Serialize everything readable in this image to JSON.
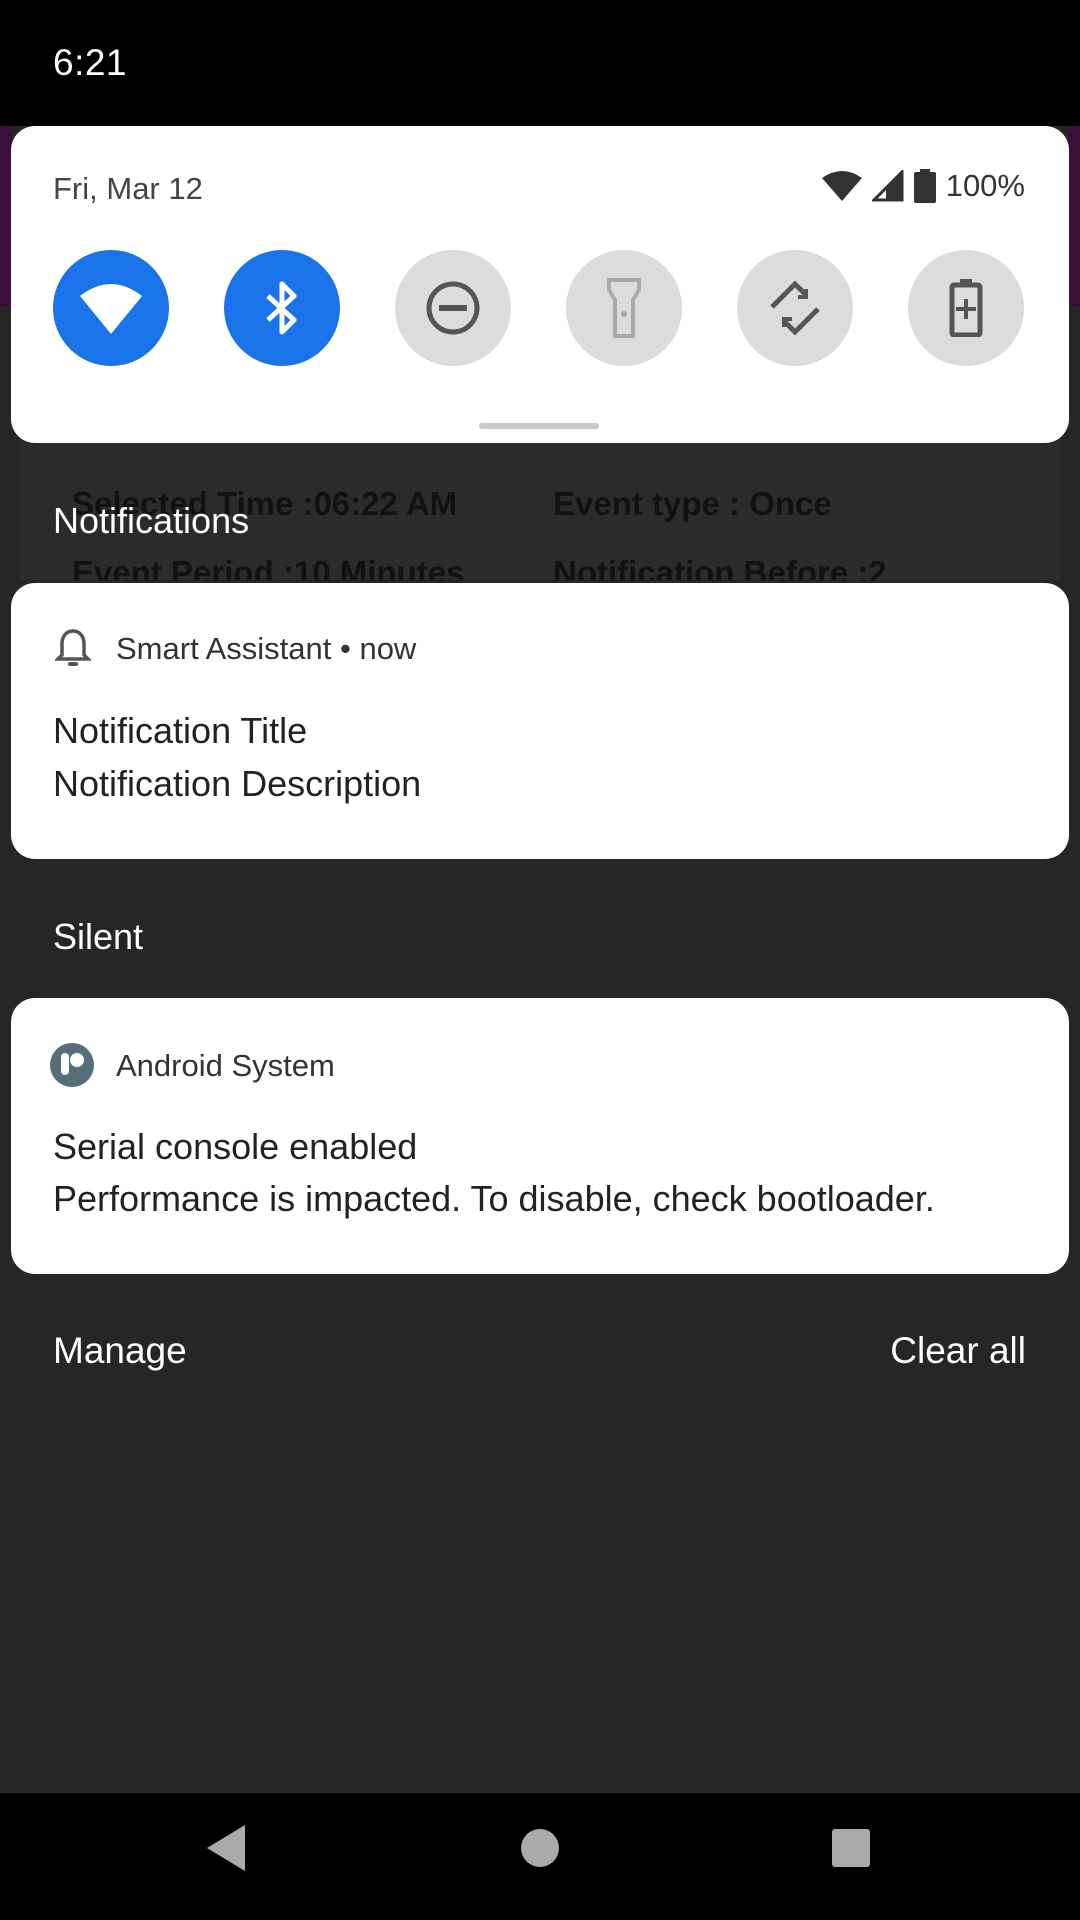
{
  "status_bar": {
    "time": "6:21"
  },
  "background_app": {
    "selected_time": "Selected Time :06:22 AM",
    "event_type": "Event type : Once",
    "event_period": "Event Period :10 Minutes",
    "notification_before": "Notification Before :2"
  },
  "quick_settings": {
    "date": "Fri, Mar 12",
    "battery_percent": "100%",
    "tiles": [
      {
        "name": "wifi",
        "icon": "wifi-icon",
        "active": true
      },
      {
        "name": "bluetooth",
        "icon": "bluetooth-icon",
        "active": true
      },
      {
        "name": "do-not-disturb",
        "icon": "do-not-disturb-icon",
        "active": false
      },
      {
        "name": "flashlight",
        "icon": "flashlight-icon",
        "active": false
      },
      {
        "name": "auto-rotate",
        "icon": "auto-rotate-icon",
        "active": false
      },
      {
        "name": "battery-saver",
        "icon": "battery-saver-icon",
        "active": false
      }
    ],
    "colors": {
      "active": "#1a73e8",
      "inactive": "#dcdcdc"
    }
  },
  "sections": {
    "notifications": "Notifications",
    "silent": "Silent"
  },
  "notifications": [
    {
      "app": "Smart Assistant",
      "time": "now",
      "title": "Notification Title",
      "text": "Notification Description",
      "icon": "bell-icon"
    },
    {
      "app": "Android System",
      "title": "Serial console enabled",
      "text": "Performance is impacted. To disable, check bootloader.",
      "icon": "android-system-icon"
    }
  ],
  "footer": {
    "manage": "Manage",
    "clear_all": "Clear all"
  },
  "nav_bar": {
    "back": "back-icon",
    "home": "home-icon",
    "recents": "recents-icon"
  }
}
